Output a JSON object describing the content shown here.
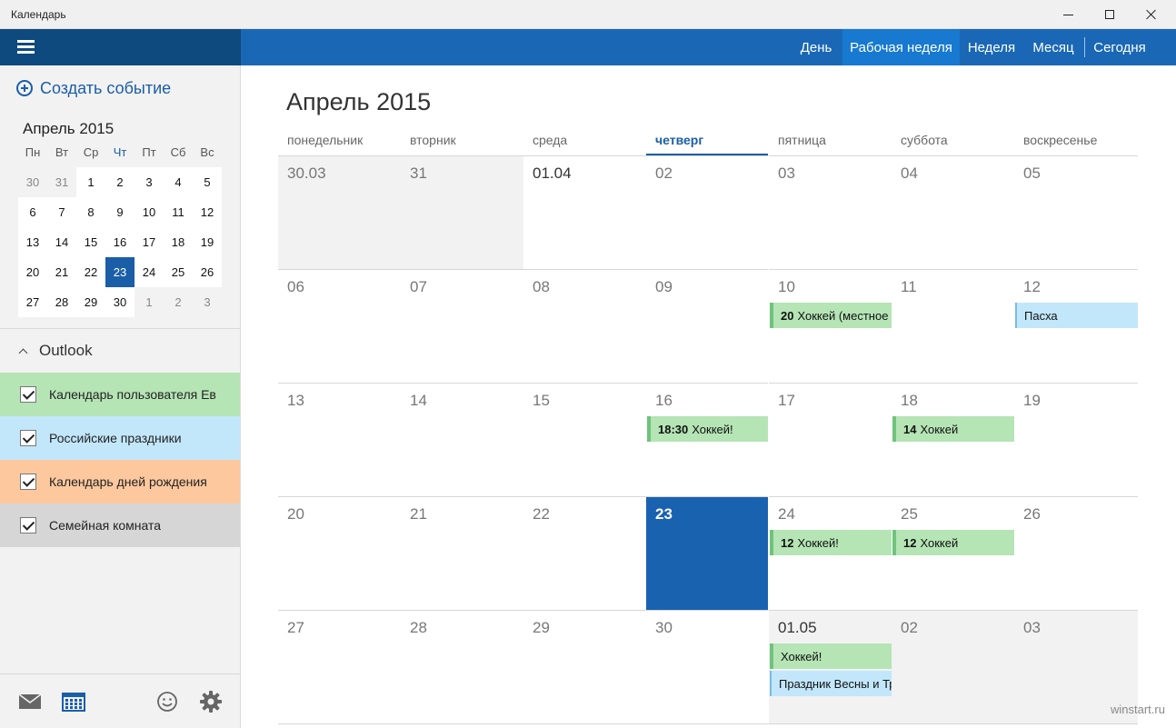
{
  "window": {
    "title": "Календарь"
  },
  "sidebar": {
    "new_event": "Создать событие",
    "mini_calendar": {
      "title": "Апрель 2015",
      "weekdays": [
        "Пн",
        "Вт",
        "Ср",
        "Чт",
        "Пт",
        "Сб",
        "Вс"
      ],
      "weeks": [
        [
          "30",
          "31",
          "1",
          "2",
          "3",
          "4",
          "5"
        ],
        [
          "6",
          "7",
          "8",
          "9",
          "10",
          "11",
          "12"
        ],
        [
          "13",
          "14",
          "15",
          "16",
          "17",
          "18",
          "19"
        ],
        [
          "20",
          "21",
          "22",
          "23",
          "24",
          "25",
          "26"
        ],
        [
          "27",
          "28",
          "29",
          "30",
          "1",
          "2",
          "3"
        ]
      ],
      "selected_day": "23"
    },
    "account": "Outlook",
    "calendars": [
      {
        "label": "Календарь пользователя Ев",
        "color": "#b5e4b5",
        "checked": true
      },
      {
        "label": "Российские праздники",
        "color": "#c2e7fb",
        "checked": true
      },
      {
        "label": "Календарь дней рождения",
        "color": "#fdc89e",
        "checked": true
      },
      {
        "label": "Семейная комната",
        "color": "#d6d6d6",
        "checked": true
      }
    ]
  },
  "nav": {
    "day": "День",
    "work_week": "Рабочая неделя",
    "week": "Неделя",
    "month": "Месяц",
    "today": "Сегодня",
    "active": "work_week"
  },
  "main": {
    "month_title": "Апрель 2015",
    "weekdays": [
      "понедельник",
      "вторник",
      "среда",
      "четверг",
      "пятница",
      "суббота",
      "воскресенье"
    ],
    "today_weekday_index": 3,
    "weeks": [
      [
        "30.03",
        "31",
        "01.04",
        "02",
        "03",
        "04",
        "05"
      ],
      [
        "06",
        "07",
        "08",
        "09",
        "10",
        "11",
        "12"
      ],
      [
        "13",
        "14",
        "15",
        "16",
        "17",
        "18",
        "19"
      ],
      [
        "20",
        "21",
        "22",
        "23",
        "24",
        "25",
        "26"
      ],
      [
        "27",
        "28",
        "29",
        "30",
        "01.05",
        "02",
        "03"
      ]
    ],
    "events": [
      {
        "week": 1,
        "day": 4,
        "slot": 0,
        "time": "20",
        "title": "Хоккей (местное в",
        "color": "green"
      },
      {
        "week": 1,
        "day": 6,
        "slot": 0,
        "time": "",
        "title": "Пасха",
        "color": "blue"
      },
      {
        "week": 2,
        "day": 3,
        "slot": 0,
        "time": "18:30",
        "title": "Хоккей!",
        "color": "green"
      },
      {
        "week": 2,
        "day": 5,
        "slot": 0,
        "time": "14",
        "title": "Хоккей",
        "color": "green"
      },
      {
        "week": 3,
        "day": 4,
        "slot": 0,
        "time": "12",
        "title": "Хоккей!",
        "color": "green"
      },
      {
        "week": 3,
        "day": 5,
        "slot": 0,
        "time": "12",
        "title": "Хоккей",
        "color": "green"
      },
      {
        "week": 4,
        "day": 4,
        "slot": 0,
        "time": "",
        "title": "Хоккей!",
        "color": "green"
      },
      {
        "week": 4,
        "day": 4,
        "slot": 1,
        "time": "",
        "title": "Праздник Весны и Тр",
        "color": "blue"
      }
    ]
  },
  "watermark": "winstart.ru",
  "colors": {
    "nav": "#1a68b5",
    "nav_active": "#1779cf",
    "hamburger_bar": "#0e4a7e",
    "accent": "#1a5ea8",
    "today_cell": "#1962b0"
  }
}
